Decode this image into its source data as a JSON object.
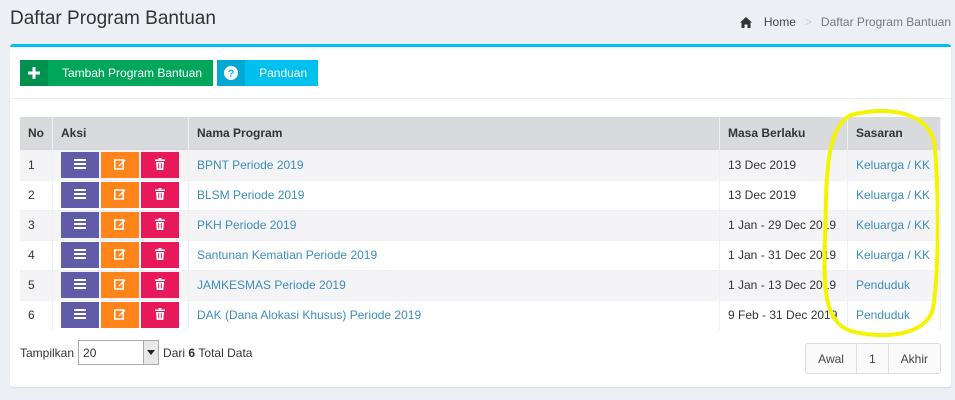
{
  "page": {
    "title": "Daftar Program Bantuan"
  },
  "breadcrumb": {
    "home": "Home",
    "separator": ">",
    "current": "Daftar Program Bantuan"
  },
  "toolbar": {
    "add_label": "Tambah Program Bantuan",
    "guide_label": "Panduan"
  },
  "table": {
    "headers": [
      "No",
      "Aksi",
      "Nama Program",
      "Masa Berlaku",
      "Sasaran"
    ],
    "rows": [
      {
        "no": "1",
        "nama": "BPNT Periode 2019",
        "masa": "13 Dec 2019",
        "sasaran": "Keluarga / KK"
      },
      {
        "no": "2",
        "nama": "BLSM Periode 2019",
        "masa": "13 Dec 2019",
        "sasaran": "Keluarga / KK"
      },
      {
        "no": "3",
        "nama": "PKH Periode 2019",
        "masa": "1 Jan - 29 Dec 2019",
        "sasaran": "Keluarga / KK"
      },
      {
        "no": "4",
        "nama": "Santunan Kematian Periode 2019",
        "masa": "1 Jan - 31 Dec 2019",
        "sasaran": "Keluarga / KK"
      },
      {
        "no": "5",
        "nama": "JAMKESMAS Periode 2019",
        "masa": "1 Jan - 13 Dec 2019",
        "sasaran": "Penduduk"
      },
      {
        "no": "6",
        "nama": "DAK (Dana Alokasi Khusus) Periode 2019",
        "masa": "9 Feb - 31 Dec 2019",
        "sasaran": "Penduduk"
      }
    ]
  },
  "footer": {
    "show_label": "Tampilkan",
    "per_page": "20",
    "total_prefix": "Dari",
    "total_count": "6",
    "total_suffix": "Total Data"
  },
  "pagination": {
    "first": "Awal",
    "page": "1",
    "last": "Akhir"
  },
  "colors": {
    "accent": "#00c0ef",
    "add": "#00a65a",
    "list": "#605ca8",
    "edit": "#ff851b",
    "delete": "#e7195a",
    "link": "#3c8dbc",
    "highlight": "#f4f400"
  }
}
